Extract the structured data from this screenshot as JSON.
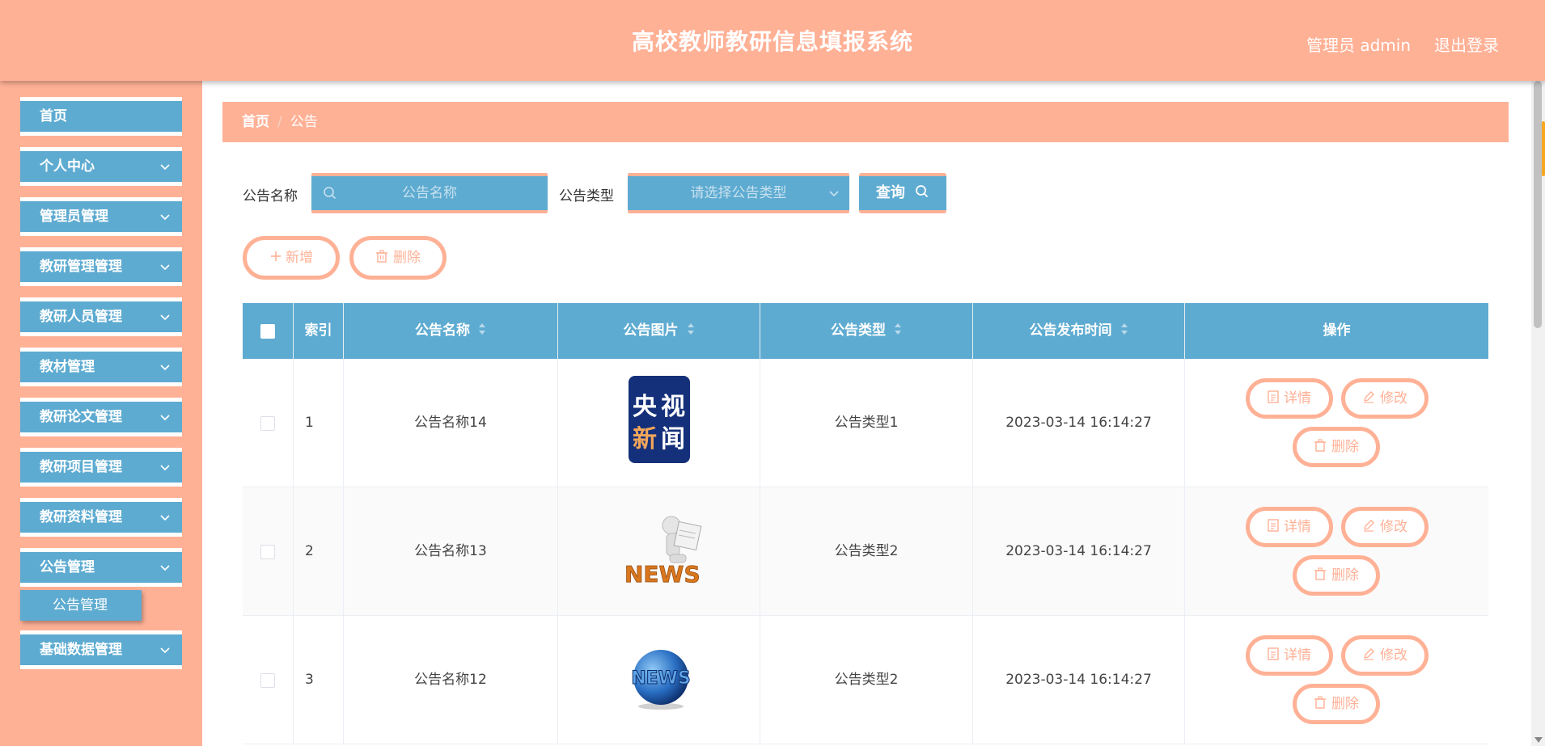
{
  "header": {
    "title": "高校教师教研信息填报系统",
    "user": "管理员 admin",
    "logout": "退出登录"
  },
  "sidebar": {
    "items": [
      {
        "label": "首页"
      },
      {
        "label": "个人中心"
      },
      {
        "label": "管理员管理"
      },
      {
        "label": "教研管理管理"
      },
      {
        "label": "教研人员管理"
      },
      {
        "label": "教材管理"
      },
      {
        "label": "教研论文管理"
      },
      {
        "label": "教研项目管理"
      },
      {
        "label": "教研资料管理"
      },
      {
        "label": "公告管理"
      },
      {
        "label": "基础数据管理"
      }
    ],
    "submenu": {
      "label": "公告管理"
    }
  },
  "breadcrumb": {
    "home": "首页",
    "sep": "/",
    "current": "公告"
  },
  "search": {
    "name_label": "公告名称",
    "name_placeholder": "公告名称",
    "type_label": "公告类型",
    "type_placeholder": "请选择公告类型",
    "query_label": "查询"
  },
  "actions": {
    "add_label": "新增",
    "delete_label": "删除"
  },
  "table": {
    "headers": [
      "索引",
      "公告名称",
      "公告图片",
      "公告类型",
      "公告发布时间",
      "操作"
    ],
    "rows": [
      {
        "index": "1",
        "name": "公告名称14",
        "image": "cctv-news",
        "type": "公告类型1",
        "time": "2023-03-14 16:14:27"
      },
      {
        "index": "2",
        "name": "公告名称13",
        "image": "news-figure",
        "type": "公告类型2",
        "time": "2023-03-14 16:14:27"
      },
      {
        "index": "3",
        "name": "公告名称12",
        "image": "news-globe",
        "type": "公告类型2",
        "time": "2023-03-14 16:14:27"
      }
    ],
    "op_labels": {
      "detail": "详情",
      "edit": "修改",
      "delete": "删除"
    }
  },
  "thumb_text": {
    "cctv": [
      "央",
      "视",
      "新",
      "闻"
    ],
    "news": "NEWS"
  },
  "colors": {
    "header_bg": "#ffb196",
    "primary": "#5eabd1",
    "accent": "#ffb196"
  }
}
